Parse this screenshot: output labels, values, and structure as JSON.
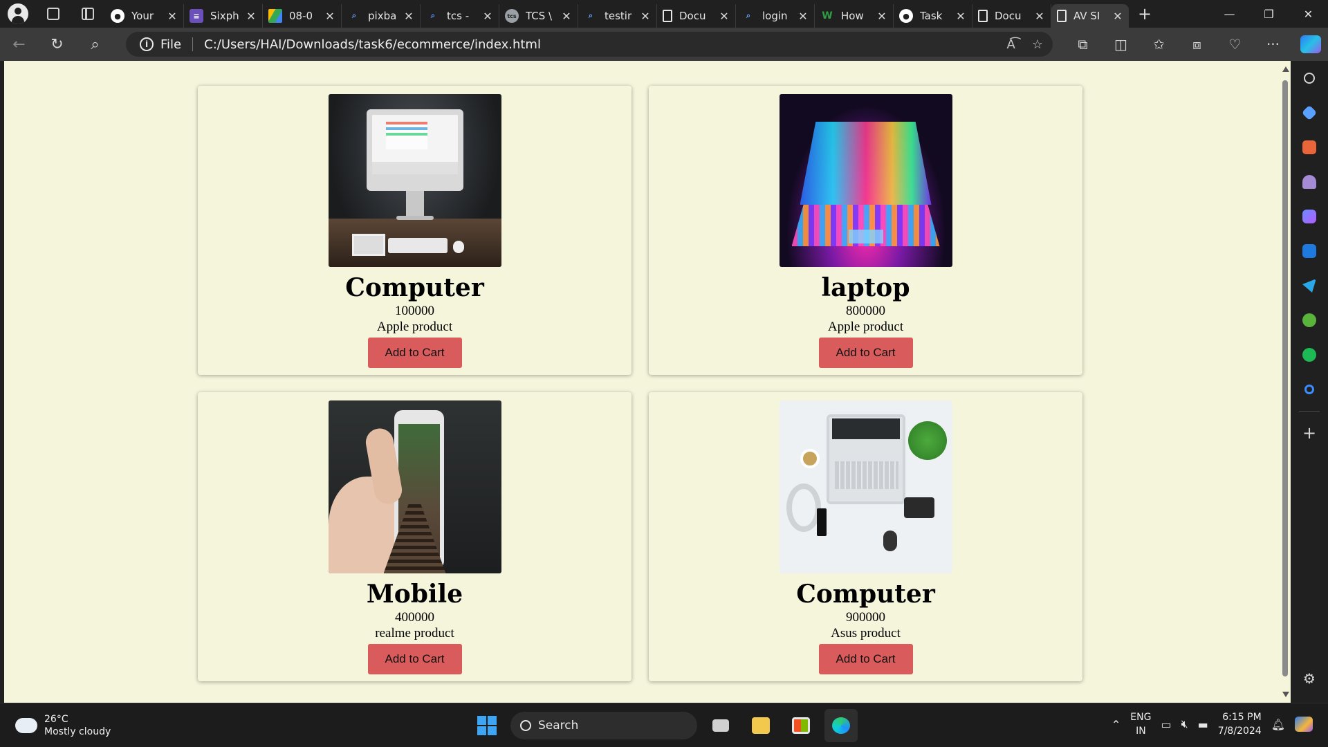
{
  "browser": {
    "tabs": [
      {
        "title": "Your",
        "favicon": "github-icon",
        "favicon_color": "#ffffff"
      },
      {
        "title": "Sixph",
        "favicon": "list-icon",
        "favicon_color": "#6b4fbb"
      },
      {
        "title": "08-0",
        "favicon": "drive-icon",
        "favicon_color": "#34a853"
      },
      {
        "title": "pixba",
        "favicon": "search-icon",
        "favicon_color": "#6aa0ff"
      },
      {
        "title": "tcs -",
        "favicon": "search-icon",
        "favicon_color": "#6aa0ff"
      },
      {
        "title": "TCS \\",
        "favicon": "tcs-icon",
        "favicon_color": "#9aa0a6"
      },
      {
        "title": "testir",
        "favicon": "search-icon",
        "favicon_color": "#6aa0ff"
      },
      {
        "title": "Docu",
        "favicon": "document-icon",
        "favicon_color": "#e6e6e6"
      },
      {
        "title": "login",
        "favicon": "search-icon",
        "favicon_color": "#6aa0ff"
      },
      {
        "title": "How",
        "favicon": "w-icon",
        "favicon_color": "#2ea043"
      },
      {
        "title": "Task",
        "favicon": "github-icon",
        "favicon_color": "#ffffff"
      },
      {
        "title": "Docu",
        "favicon": "document-icon",
        "favicon_color": "#e6e6e6"
      },
      {
        "title": "AV SI",
        "favicon": "document-icon",
        "favicon_color": "#e6e6e6",
        "active": true
      }
    ],
    "address": {
      "scheme_label": "File",
      "url": "C:/Users/HAI/Downloads/task6/ecommerce/index.html"
    }
  },
  "page": {
    "background": "#f5f5dc",
    "products": [
      {
        "name": "Computer",
        "price": "100000",
        "description": "Apple product",
        "button": "Add to Cart",
        "image": "desktop-computer-image"
      },
      {
        "name": "laptop",
        "price": "800000",
        "description": "Apple product",
        "button": "Add to Cart",
        "image": "laptop-image"
      },
      {
        "name": "Mobile",
        "price": "400000",
        "description": "realme product",
        "button": "Add to Cart",
        "image": "mobile-phone-image"
      },
      {
        "name": "Computer",
        "price": "900000",
        "description": "Asus product",
        "button": "Add to Cart",
        "image": "desk-flatlay-image"
      }
    ],
    "button_color": "#d95b5b"
  },
  "taskbar": {
    "weather": {
      "temp": "26°C",
      "condition": "Mostly cloudy"
    },
    "search_label": "Search",
    "lang_line1": "ENG",
    "lang_line2": "IN",
    "time": "6:15 PM",
    "date": "7/8/2024"
  }
}
